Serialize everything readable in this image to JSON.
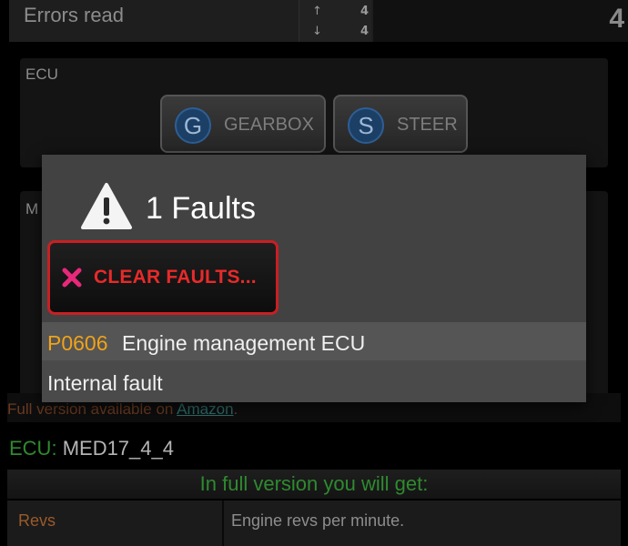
{
  "header": {
    "title": "Errors read",
    "count_up": "4",
    "count_down": "4",
    "total": "4",
    "arrow_up": "↑",
    "arrow_down": "↓"
  },
  "ecu_panel": {
    "title": "ECU",
    "modules": [
      {
        "letter": "G",
        "label": "GEARBOX"
      },
      {
        "letter": "S",
        "label": "STEER"
      }
    ]
  },
  "second_panel": {
    "title_visible_fragment": "M"
  },
  "dialog": {
    "title": "1 Faults",
    "clear_button": "CLEAR FAULTS...",
    "faults": [
      {
        "code": "P0606",
        "description": "Engine management ECU",
        "detail": "Internal fault"
      }
    ]
  },
  "promo": {
    "text": "Full version available on ",
    "link": "Amazon",
    "suffix": "."
  },
  "ecu_info": {
    "key": "ECU:",
    "value": "MED17_4_4"
  },
  "full_version": {
    "heading": "In full version you will get:",
    "features": [
      {
        "name": "Revs",
        "description": "Engine revs per minute."
      }
    ]
  },
  "colors": {
    "fault_code": "#f0a318",
    "clear_button_border": "#c91f23",
    "clear_button_text": "#e82a2a",
    "green_text": "#2f8a2f",
    "dialog_bg": "#424242"
  },
  "icons": {
    "warning": "warning-triangle-icon",
    "clear": "close-x-icon"
  }
}
